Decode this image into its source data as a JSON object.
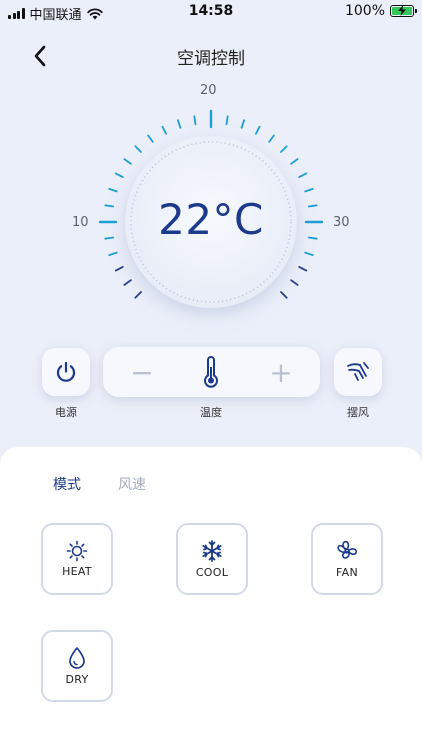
{
  "status_bar": {
    "carrier": "中国联通",
    "time": "14:58",
    "battery": "100%"
  },
  "header": {
    "title": "空调控制",
    "back_icon": "chevron-left-icon"
  },
  "dial": {
    "current_temp": "22°C",
    "min_label": "10",
    "mid_label": "20",
    "max_label": "30",
    "tick_color": "#1d9fd6",
    "tick_dark_color": "#2a3f8f"
  },
  "controls": {
    "power_label": "电源",
    "temp_label": "温度",
    "swing_label": "摆风",
    "minus": "−",
    "plus": "+"
  },
  "tabs": [
    {
      "label": "模式"
    },
    {
      "label": "风速"
    }
  ],
  "modes": [
    {
      "label": "HEAT",
      "icon": "sun-icon"
    },
    {
      "label": "COOL",
      "icon": "snowflake-icon"
    },
    {
      "label": "FAN",
      "icon": "fan-icon"
    },
    {
      "label": "DRY",
      "icon": "droplet-icon"
    }
  ],
  "colors": {
    "accent": "#1b3a8c",
    "background": "#ebeff9",
    "inactive_tab": "#a6adbd"
  }
}
